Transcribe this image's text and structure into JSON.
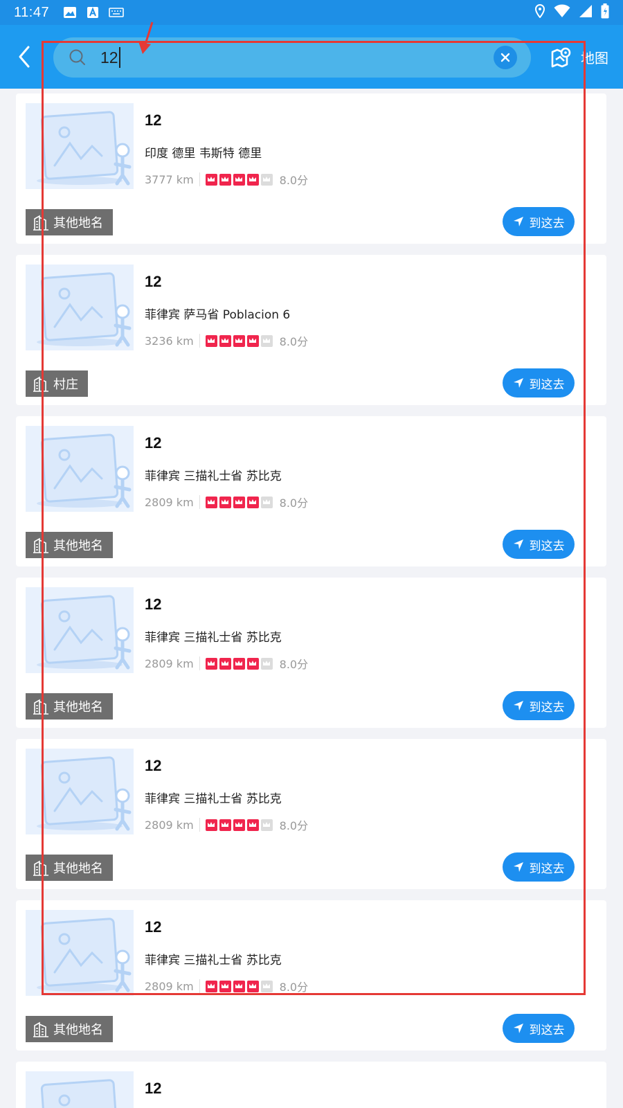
{
  "status_bar": {
    "time": "11:47"
  },
  "header": {
    "search_value": "12",
    "map_label": "地图"
  },
  "results": [
    {
      "title": "12",
      "address": "印度 德里 韦斯特 德里",
      "distance": "3777 km",
      "rating": 4,
      "rating_max": 5,
      "score": "8.0分",
      "type": "其他地名",
      "go_label": "到这去"
    },
    {
      "title": "12",
      "address": "菲律宾 萨马省  Poblacion 6",
      "distance": "3236 km",
      "rating": 4,
      "rating_max": 5,
      "score": "8.0分",
      "type": "村庄",
      "go_label": "到这去"
    },
    {
      "title": "12",
      "address": "菲律宾 三描礼士省 苏比克",
      "distance": "2809 km",
      "rating": 4,
      "rating_max": 5,
      "score": "8.0分",
      "type": "其他地名",
      "go_label": "到这去"
    },
    {
      "title": "12",
      "address": "菲律宾 三描礼士省 苏比克",
      "distance": "2809 km",
      "rating": 4,
      "rating_max": 5,
      "score": "8.0分",
      "type": "其他地名",
      "go_label": "到这去"
    },
    {
      "title": "12",
      "address": "菲律宾 三描礼士省 苏比克",
      "distance": "2809 km",
      "rating": 4,
      "rating_max": 5,
      "score": "8.0分",
      "type": "其他地名",
      "go_label": "到这去"
    },
    {
      "title": "12",
      "address": "菲律宾 三描礼士省 苏比克",
      "distance": "2809 km",
      "rating": 4,
      "rating_max": 5,
      "score": "8.0分",
      "type": "其他地名",
      "go_label": "到这去"
    },
    {
      "title": "12",
      "address": "",
      "distance": "",
      "rating": 0,
      "rating_max": 5,
      "score": "",
      "type": "",
      "go_label": ""
    }
  ],
  "colors": {
    "header": "#1e9bf0",
    "accent": "#1d8ff0",
    "star": "#f0254d",
    "annotation": "#e53935"
  }
}
